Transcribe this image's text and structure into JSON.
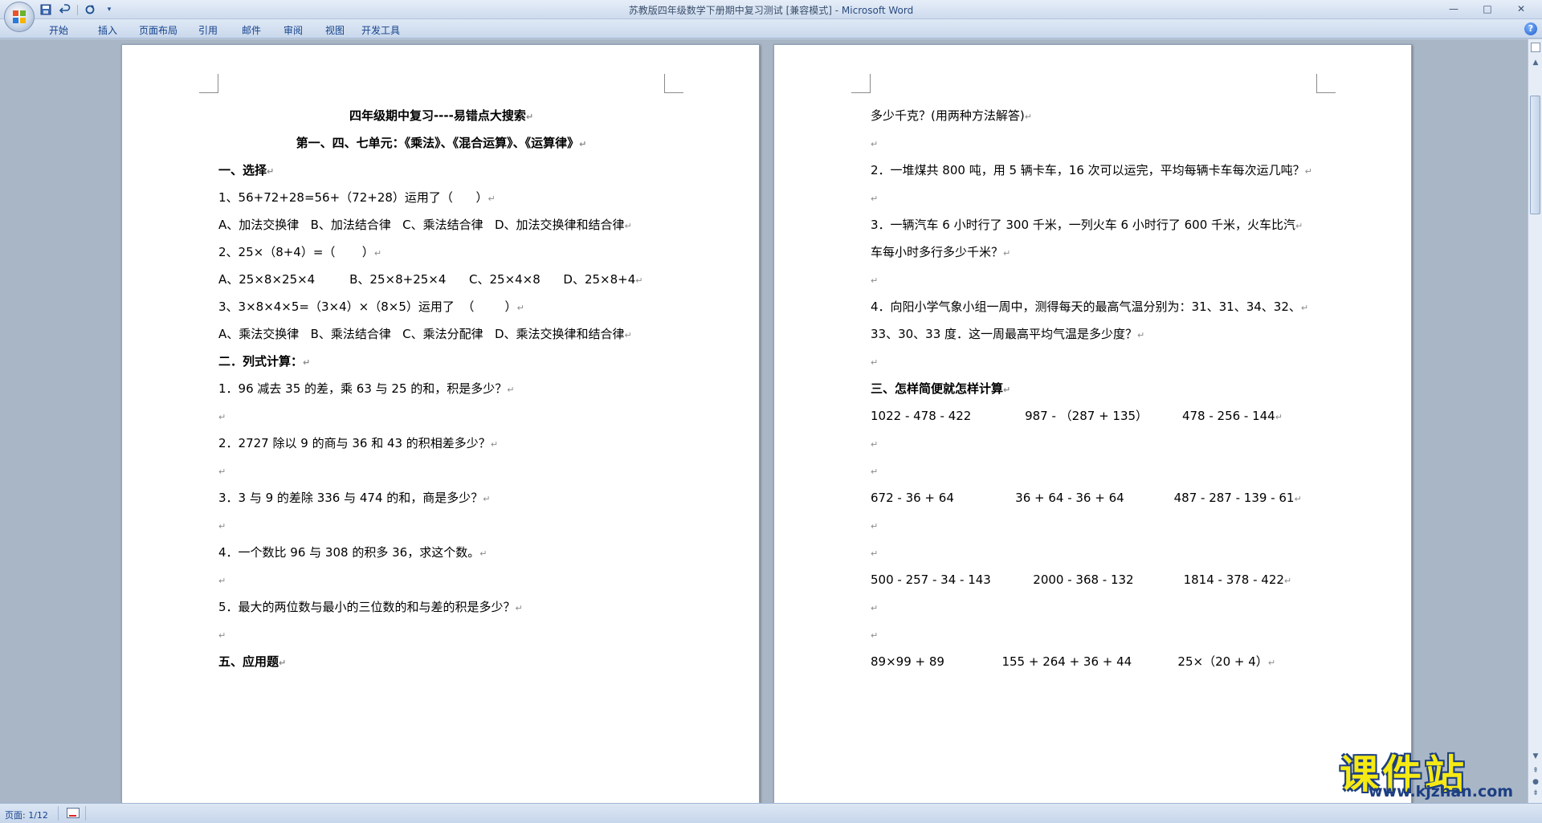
{
  "window": {
    "title_doc": "苏教版四年级数学下册期中复习测试 [兼容模式] - ",
    "title_app": "Microsoft Word",
    "controls": [
      "—",
      "□",
      "✕"
    ]
  },
  "quick_access": [
    "save-icon",
    "undo-icon",
    "redo-icon",
    "customize-icon"
  ],
  "ribbon": {
    "tabs": [
      "开始",
      "插入",
      "页面布局",
      "引用",
      "邮件",
      "审阅",
      "视图",
      "开发工具"
    ]
  },
  "pages": {
    "left": [
      "四年级期中复习----易错点大搜索",
      "第一、四、七单元：《乘法》、《混合运算》、《运算律》",
      "一、选择",
      "1、56+72+28=56+（72+28）运用了（      ）",
      "A、加法交换律   B、加法结合律   C、乘法结合律   D、加法交换律和结合律",
      "2、25×（8+4）=（       ）",
      "A、25×8×25×4         B、25×8+25×4      C、25×4×8      D、25×8+4",
      "3、3×8×4×5=（3×4）×（8×5）运用了  （        ）",
      "A、乘法交换律   B、乘法结合律   C、乘法分配律   D、乘法交换律和结合律",
      "二．列式计算：",
      "1．96 减去 35 的差，乘 63 与 25 的和，积是多少？",
      "",
      "2．2727 除以 9 的商与 36 和 43 的积相差多少？",
      "",
      "3．3 与 9 的差除 336 与 474 的和，商是多少？",
      "",
      "4．一个数比 96 与 308 的积多 36，求这个数。",
      "",
      "5．最大的两位数与最小的三位数的和与差的积是多少？",
      "",
      "五、应用题"
    ],
    "right": [
      "多少千克？(用两种方法解答)",
      "",
      "2．一堆煤共 800 吨，用 5 辆卡车，16 次可以运完，平均每辆卡车每次运几吨？",
      "",
      "3．一辆汽车 6 小时行了 300 千米，一列火车 6 小时行了 600 千米，火车比汽",
      "车每小时多行多少千米？",
      "",
      "4．向阳小学气象小组一周中，测得每天的最高气温分别为：31、31、34、32、",
      "33、30、33 度．这一周最高平均气温是多少度？",
      "",
      "三、怎样简便就怎样计算",
      "1022 - 478 - 422              987 - （287 + 135）         478 - 256 - 144",
      "",
      "",
      "672 - 36 + 64                36 + 64 - 36 + 64             487 - 287 - 139 - 61",
      "",
      "",
      "500 - 257 - 34 - 143           2000 - 368 - 132             1814 - 378 - 422",
      "",
      "",
      "89×99 + 89               155 + 264 + 36 + 44            25×（20 + 4）"
    ]
  },
  "status": {
    "page": "页面: 1/12"
  },
  "watermark": {
    "cn": "课件站",
    "url": "www.kjzhan.com"
  }
}
